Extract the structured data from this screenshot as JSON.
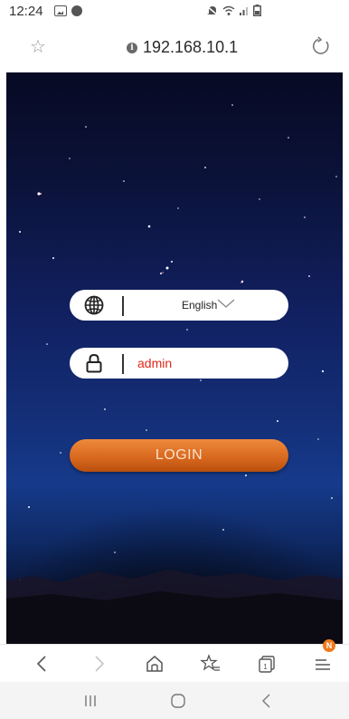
{
  "status_bar": {
    "time": "12:24",
    "icons": [
      "gallery-icon",
      "notification-dot-icon",
      "silent-icon",
      "wifi-icon",
      "signal-icon",
      "battery-icon"
    ]
  },
  "browser": {
    "url": "192.168.10.1",
    "icons": [
      "star-icon",
      "info-icon",
      "reload-icon"
    ]
  },
  "login": {
    "language_value": "English",
    "password_value": "admin",
    "login_label": "LOGIN",
    "accent_color": "#d7661d",
    "password_color": "#e0271b"
  },
  "toolbar": {
    "badge": "N",
    "icons": [
      "back-icon",
      "forward-icon",
      "home-icon",
      "bookmarks-icon",
      "tabs-icon",
      "menu-icon"
    ]
  },
  "navbar": {
    "icons": [
      "recents-icon",
      "home-circle-icon",
      "back-icon"
    ]
  }
}
